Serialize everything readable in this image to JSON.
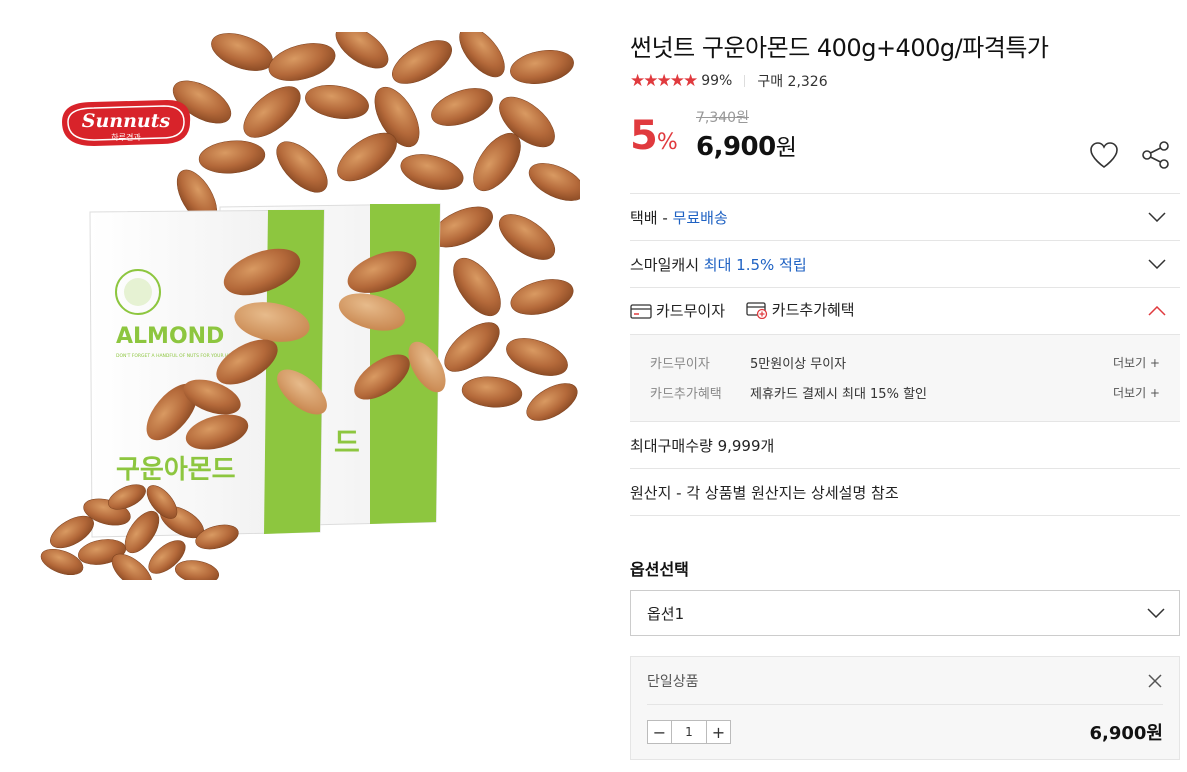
{
  "product_image": {
    "brand_logo": "Sunnuts",
    "brand_logo_sub": "하루견과",
    "package_label": "ALMOND",
    "package_tagline": "DON'T FORGET A HANDFUL OF NUTS FOR YOUR HEALTH",
    "package_korean": "구운아몬드"
  },
  "product": {
    "title": "썬넛트 구운아몬드 400g+400g/파격특가",
    "stars": "★★★★★",
    "rating": "99%",
    "purchases": "구매 2,326"
  },
  "price": {
    "original": "7,340원",
    "discount_value": "5",
    "discount_unit": "%",
    "sale_value": "6,900",
    "sale_unit": "원"
  },
  "icons": {
    "wish": "heart-icon",
    "share": "share-icon",
    "chevron": "chevron-down-icon",
    "chevron_up": "chevron-up-icon",
    "close": "close-icon",
    "card": "card-icon",
    "card_plus": "card-plus-icon"
  },
  "colors": {
    "accent_red": "#e03a3e",
    "link_blue": "#1f62c3"
  },
  "shipping": {
    "label": "택배 - ",
    "value": "무료배송"
  },
  "smilecash": {
    "label": "스마일캐시 ",
    "value": "최대 1.5% 적립"
  },
  "cards": {
    "tab_installment": "카드무이자",
    "tab_benefit": "카드추가혜택",
    "details": [
      {
        "label": "카드무이자",
        "value": "5만원이상 무이자",
        "more": "더보기 +"
      },
      {
        "label": "카드추가혜택",
        "value": "제휴카드 결제시 최대 15% 할인",
        "more": "더보기 +"
      }
    ]
  },
  "max_purchase": "최대구매수량 9,999개",
  "origin": "원산지 - 각 상품별 원산지는 상세설명 참조",
  "options": {
    "title": "옵션선택",
    "selected": "옵션1"
  },
  "selected_item": {
    "name": "단일상품",
    "quantity": "1",
    "minus": "−",
    "plus": "+",
    "price": "6,900원"
  }
}
